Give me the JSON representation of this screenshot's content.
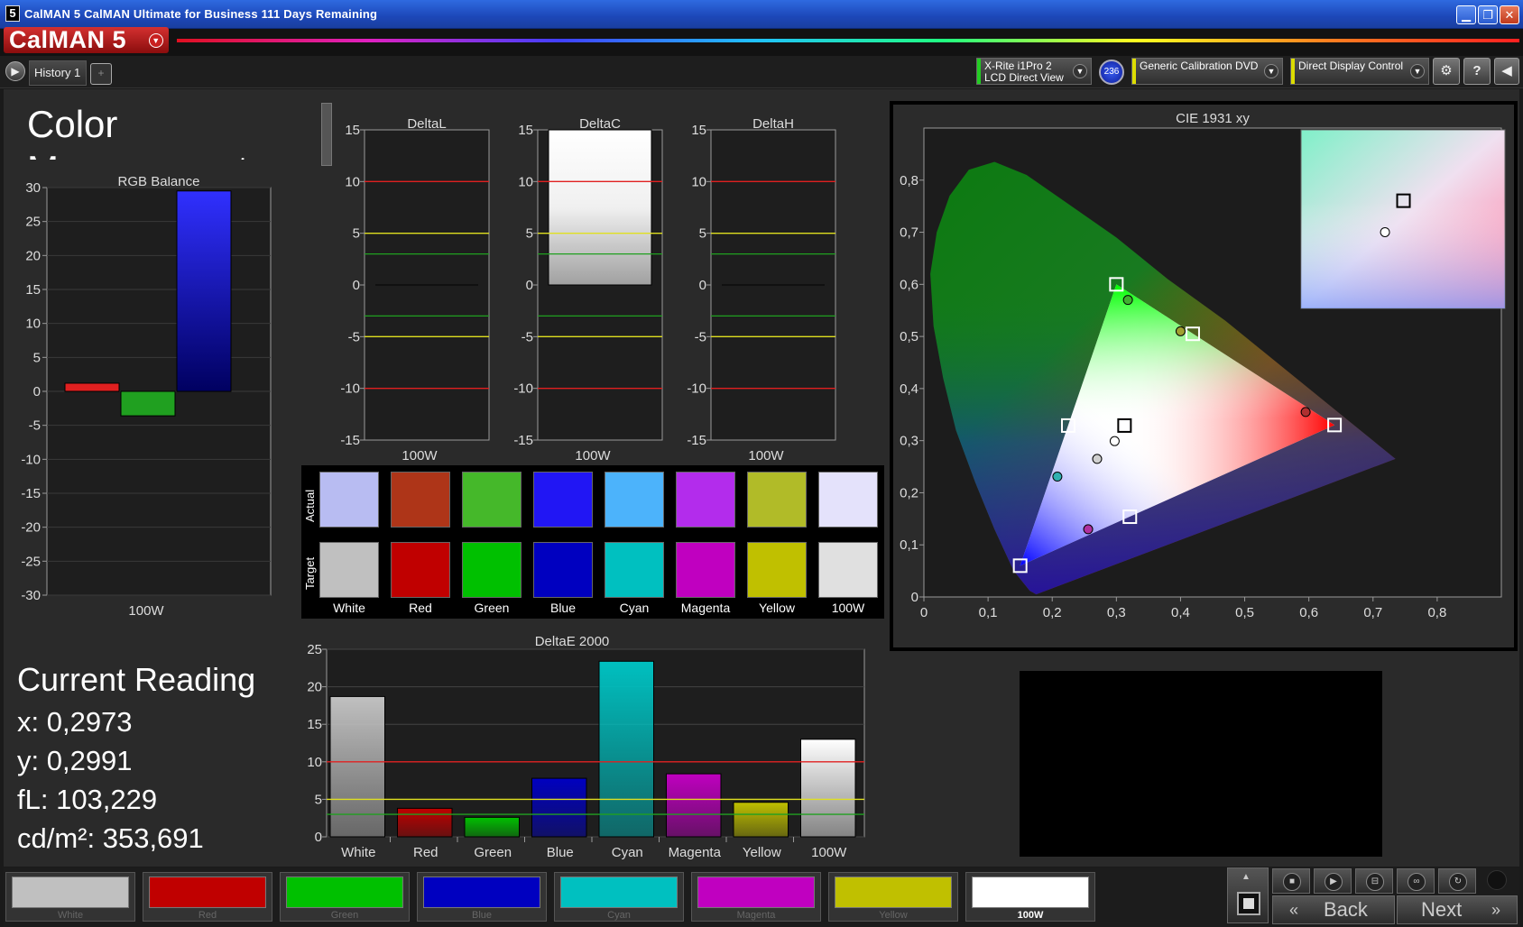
{
  "window": {
    "title": "CalMAN 5 CalMAN Ultimate for Business 111 Days Remaining",
    "icon_glyph": "5",
    "controls": [
      "minimize-icon",
      "restore-icon",
      "close-icon"
    ]
  },
  "logo": {
    "text": "CalMAN 5"
  },
  "toolbar": {
    "history_tab": "History 1",
    "add_tab": "+",
    "meter": {
      "line1": "X-Rite i1Pro 2",
      "line2": "LCD Direct View",
      "stripe_color": "#22cc22"
    },
    "meter_badge": "236",
    "source": {
      "line1": "Generic Calibration DVD",
      "stripe_color": "#dddd00"
    },
    "display": {
      "line1": "Direct Display Control",
      "stripe_color": "#dddd00"
    },
    "settings_icon": "gear-icon",
    "help_label": "?",
    "collapse_icon": "chevron-left-icon"
  },
  "page": {
    "title_line1": "Color",
    "title_line2": "Management"
  },
  "rgb_balance": {
    "title": "RGB Balance",
    "category": "100W",
    "yticks": [
      "30",
      "25",
      "20",
      "15",
      "10",
      "5",
      "0",
      "-5",
      "-10",
      "-15",
      "-20",
      "-25",
      "-30"
    ],
    "ylim": [
      -30,
      30
    ],
    "values": {
      "red": 1.2,
      "green": -3.6,
      "blue": 29.5
    }
  },
  "delta_charts": [
    {
      "title": "DeltaL",
      "category": "100W",
      "value": 0.0
    },
    {
      "title": "DeltaC",
      "category": "100W",
      "value": 15.0
    },
    {
      "title": "DeltaH",
      "category": "100W",
      "value": 0.0
    }
  ],
  "delta_ticks": [
    "15",
    "10",
    "5",
    "0",
    "-5",
    "-10",
    "-15"
  ],
  "swatch_grid": {
    "actual_label": "Actual",
    "target_label": "Target",
    "names": [
      "White",
      "Red",
      "Green",
      "Blue",
      "Cyan",
      "Magenta",
      "Yellow",
      "100W"
    ],
    "actual": [
      "#b8bcf2",
      "#ae3518",
      "#45b82a",
      "#2116f4",
      "#4cb3fb",
      "#b32cec",
      "#b1bb28",
      "#e4e2fb"
    ],
    "target": [
      "#c0c0c0",
      "#c00000",
      "#00c000",
      "#0000c0",
      "#00c0c0",
      "#c000c0",
      "#c0c000",
      "#e0e0e0"
    ]
  },
  "cie": {
    "title": "CIE 1931 xy",
    "xticks": [
      "0",
      "0,1",
      "0,2",
      "0,3",
      "0,4",
      "0,5",
      "0,6",
      "0,7",
      "0,8"
    ],
    "yticks": [
      "0",
      "0,1",
      "0,2",
      "0,3",
      "0,4",
      "0,5",
      "0,6",
      "0,7",
      "0,8"
    ],
    "targets": [
      {
        "name": "Red",
        "x": 0.64,
        "y": 0.33
      },
      {
        "name": "Green",
        "x": 0.3,
        "y": 0.6
      },
      {
        "name": "Blue",
        "x": 0.15,
        "y": 0.06
      },
      {
        "name": "Cyan",
        "x": 0.225,
        "y": 0.329
      },
      {
        "name": "Magenta",
        "x": 0.321,
        "y": 0.154
      },
      {
        "name": "Yellow",
        "x": 0.419,
        "y": 0.505
      },
      {
        "name": "White",
        "x": 0.3127,
        "y": 0.329
      }
    ],
    "measured": [
      {
        "name": "Red",
        "x": 0.595,
        "y": 0.355,
        "color": "#b03030"
      },
      {
        "name": "Green",
        "x": 0.318,
        "y": 0.57,
        "color": "#40b030"
      },
      {
        "name": "Yellow",
        "x": 0.4,
        "y": 0.51,
        "color": "#a0a030"
      },
      {
        "name": "Cyan",
        "x": 0.208,
        "y": 0.231,
        "color": "#30b0b0"
      },
      {
        "name": "Magenta",
        "x": 0.256,
        "y": 0.13,
        "color": "#b030a0"
      },
      {
        "name": "White",
        "x": 0.2973,
        "y": 0.2991,
        "color": "#ffffff"
      },
      {
        "name": "100W",
        "x": 0.27,
        "y": 0.265,
        "color": "#d0d0d0"
      }
    ],
    "inset": {
      "target": {
        "x": 0.3127,
        "y": 0.329
      },
      "measured": {
        "x": 0.2973,
        "y": 0.2991
      }
    }
  },
  "reading": {
    "title": "Current Reading",
    "x": "x: 0,2973",
    "y": "y: 0,2991",
    "fl": "fL: 103,229",
    "cdm2": "cd/m²: 353,691"
  },
  "chart_data": {
    "type": "bar",
    "title": "DeltaE 2000",
    "categories": [
      "White",
      "Red",
      "Green",
      "Blue",
      "Cyan",
      "Magenta",
      "Yellow",
      "100W"
    ],
    "values": [
      18.7,
      3.8,
      2.6,
      7.8,
      23.4,
      8.4,
      4.6,
      13.0
    ],
    "colors": [
      "#c0c0c0",
      "#c00000",
      "#00c000",
      "#0000c0",
      "#00c0c0",
      "#c000c0",
      "#c0c000",
      "#ffffff"
    ],
    "yticks": [
      "25",
      "20",
      "15",
      "10",
      "5",
      "0"
    ],
    "ylim": [
      0,
      25
    ],
    "thresholds": [
      {
        "value": 10,
        "color": "#e02020"
      },
      {
        "value": 5,
        "color": "#e0e020"
      },
      {
        "value": 3,
        "color": "#20a020"
      }
    ]
  },
  "bottom": {
    "swatches": [
      {
        "label": "White",
        "color": "#c0c0c0"
      },
      {
        "label": "Red",
        "color": "#c00000"
      },
      {
        "label": "Green",
        "color": "#00c000"
      },
      {
        "label": "Blue",
        "color": "#0000c0"
      },
      {
        "label": "Cyan",
        "color": "#00c0c0"
      },
      {
        "label": "Magenta",
        "color": "#c000c0"
      },
      {
        "label": "Yellow",
        "color": "#c0c000"
      },
      {
        "label": "100W",
        "color": "#ffffff"
      }
    ],
    "back_label": "Back",
    "next_label": "Next"
  }
}
